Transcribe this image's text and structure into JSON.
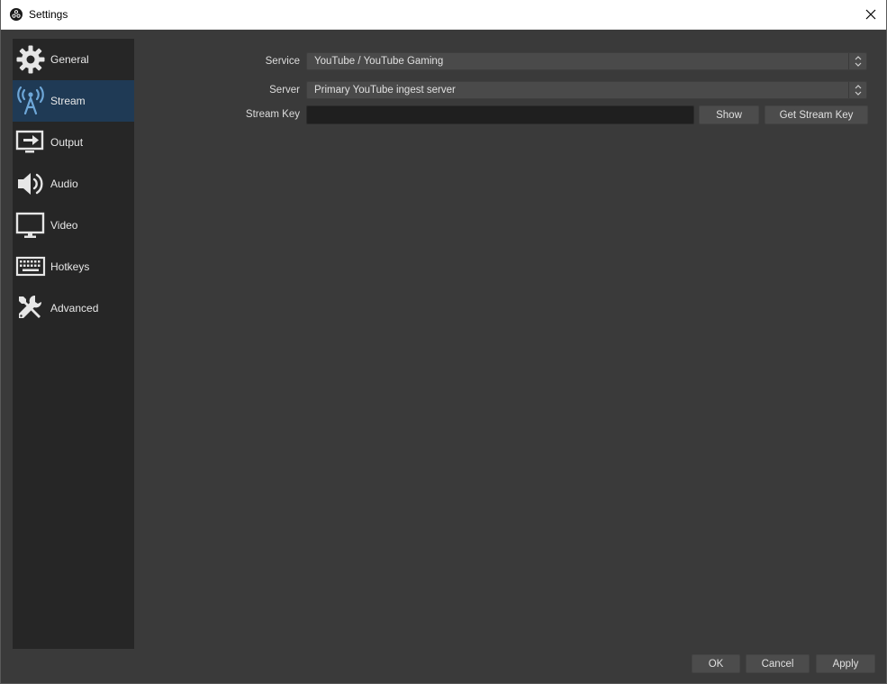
{
  "window": {
    "title": "Settings",
    "logo_icon": "obs-logo-icon",
    "close_icon": "close-icon"
  },
  "sidebar": {
    "items": [
      {
        "label": "General",
        "icon": "gear-icon",
        "selected": false
      },
      {
        "label": "Stream",
        "icon": "antenna-icon",
        "selected": true
      },
      {
        "label": "Output",
        "icon": "output-icon",
        "selected": false
      },
      {
        "label": "Audio",
        "icon": "speaker-icon",
        "selected": false
      },
      {
        "label": "Video",
        "icon": "monitor-icon",
        "selected": false
      },
      {
        "label": "Hotkeys",
        "icon": "keyboard-icon",
        "selected": false
      },
      {
        "label": "Advanced",
        "icon": "tools-icon",
        "selected": false
      }
    ]
  },
  "stream": {
    "service_label": "Service",
    "service_value": "YouTube / YouTube Gaming",
    "server_label": "Server",
    "server_value": "Primary YouTube ingest server",
    "stream_key_label": "Stream Key",
    "stream_key_value": "",
    "show_button": "Show",
    "get_stream_key_button": "Get Stream Key"
  },
  "footer": {
    "ok": "OK",
    "cancel": "Cancel",
    "apply": "Apply"
  },
  "colors": {
    "background": "#3a3a3a",
    "sidebar": "#262626",
    "selected": "#1f3a55",
    "icon": "#e6e6e6",
    "stream_icon": "#6ea7d8"
  }
}
